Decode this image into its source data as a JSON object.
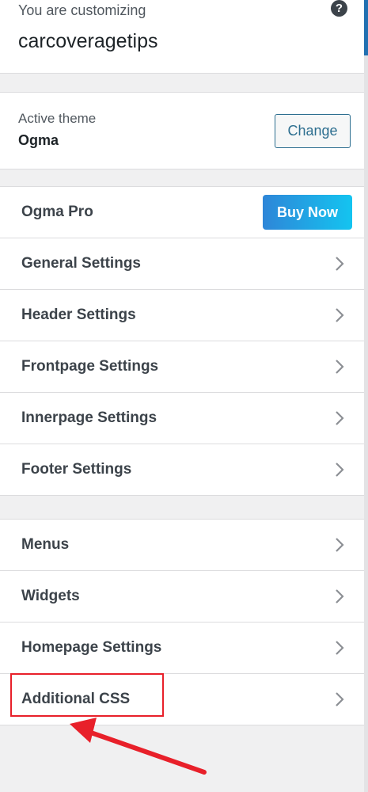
{
  "header": {
    "customizing_label": "You are customizing",
    "site_title": "carcoveragetips",
    "help_symbol": "?"
  },
  "theme": {
    "label": "Active theme",
    "name": "Ogma",
    "change_label": "Change"
  },
  "group_a": {
    "pro": {
      "label": "Ogma Pro",
      "buy_label": "Buy Now"
    },
    "items": [
      "General Settings",
      "Header Settings",
      "Frontpage Settings",
      "Innerpage Settings",
      "Footer Settings"
    ]
  },
  "group_b": {
    "items": [
      "Menus",
      "Widgets",
      "Homepage Settings",
      "Additional CSS"
    ]
  },
  "annotation": {
    "highlight_color": "#e8202a",
    "highlighted_item": "Additional CSS"
  },
  "colors": {
    "accent": "#2c6e8f",
    "buy_gradient_start": "#2e86d8",
    "buy_gradient_end": "#14c4f0"
  }
}
